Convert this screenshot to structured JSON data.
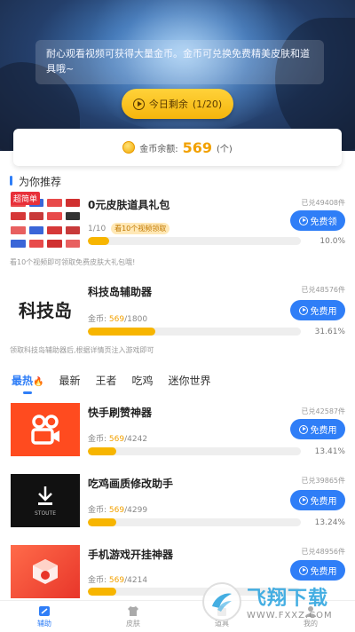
{
  "hero": {
    "notice": "耐心观看视频可获得大量金币。金币可兑换免费精美皮肤和道具哦~",
    "remain_label": "今日剩余",
    "remain_count": "(1/20)"
  },
  "coins": {
    "label": "金币余额:",
    "value": "569",
    "unit": "(个)"
  },
  "recommend": {
    "title": "为你推荐",
    "items": [
      {
        "tag": "超简单",
        "title": "0元皮肤道具礼包",
        "seen": "已兑49408件",
        "button": "免费领",
        "progress_text": "1/10",
        "hint": "看10个视频领取",
        "progress": 0.1,
        "percent": "10.0%",
        "desc": "看10个视频即可领取免费皮肤大礼包哦!"
      },
      {
        "logo_text": "科技岛",
        "title": "科技岛辅助器",
        "seen": "已兑48576件",
        "button": "免费用",
        "coin_label": "金币:",
        "coin_have": "569",
        "coin_need": "/1800",
        "progress": 0.3161,
        "percent": "31.61%",
        "desc": "领取科技岛辅助器后,根据详情页注入游戏即可"
      }
    ]
  },
  "tabs": [
    {
      "label": "最热",
      "icon": "fire-icon"
    },
    {
      "label": "最新"
    },
    {
      "label": "王者"
    },
    {
      "label": "吃鸡"
    },
    {
      "label": "迷你世界"
    }
  ],
  "list": [
    {
      "title": "快手刷赞神器",
      "seen": "已兑42587件",
      "button": "免费用",
      "coin_label": "金币:",
      "coin_have": "569",
      "coin_need": "/4242",
      "progress": 0.1341,
      "percent": "13.41%"
    },
    {
      "title": "吃鸡画质修改助手",
      "seen": "已兑39865件",
      "button": "免费用",
      "coin_label": "金币:",
      "coin_have": "569",
      "coin_need": "/4299",
      "progress": 0.1324,
      "percent": "13.24%",
      "thumb_text": "STOUTE"
    },
    {
      "title": "手机游戏开挂神器",
      "seen": "已兑48956件",
      "button": "免费用",
      "coin_label": "金币:",
      "coin_have": "569",
      "coin_need": "/4214",
      "progress": 0.135
    }
  ],
  "bottom_nav": [
    {
      "label": "辅助",
      "icon": "assist-icon",
      "active": true
    },
    {
      "label": "皮肤",
      "icon": "shirt-icon"
    },
    {
      "label": "道具",
      "icon": "props-icon"
    },
    {
      "label": "我的",
      "icon": "profile-icon"
    }
  ],
  "watermark": {
    "cn": "飞翔下载",
    "url": "WWW.FXXZ.COM"
  },
  "colors": {
    "accent": "#2f7ef7",
    "coin": "#f2a100",
    "progress": "#f7b500"
  }
}
